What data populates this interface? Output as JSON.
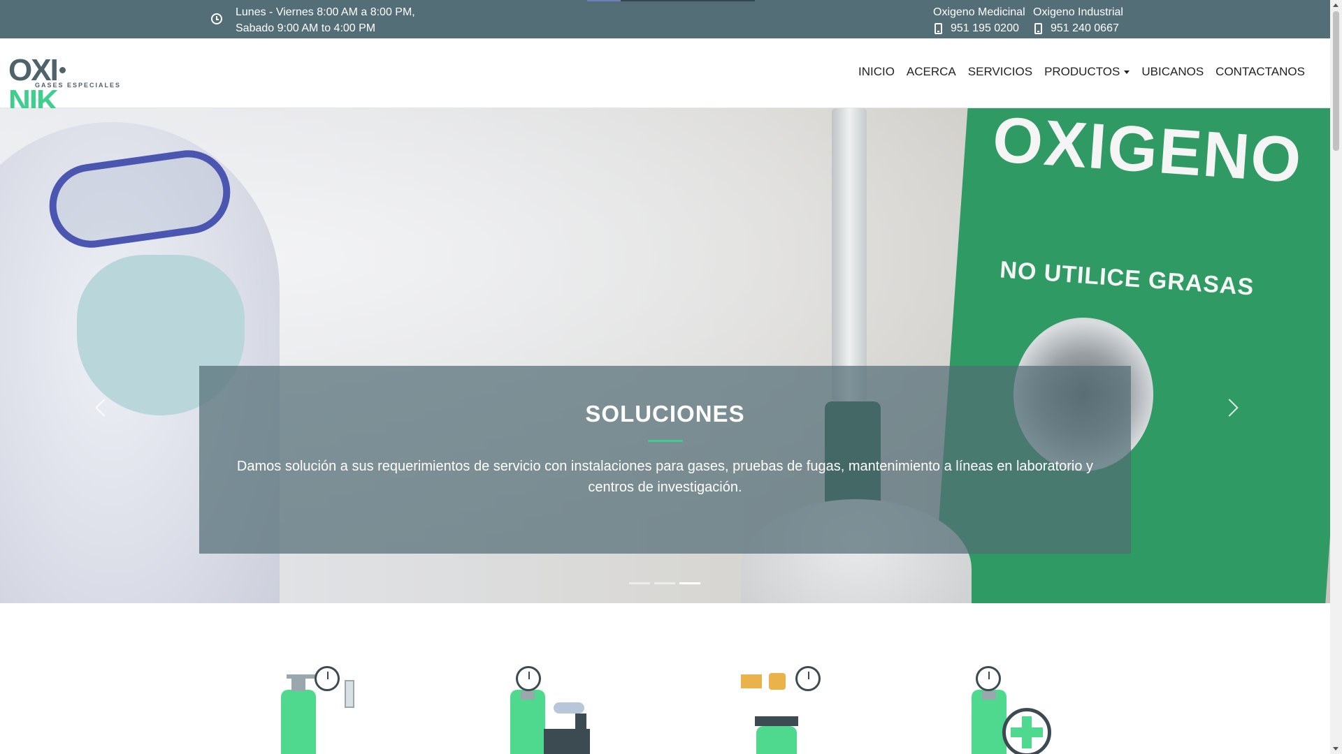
{
  "topbar": {
    "hours_line1": "Lunes - Viernes 8:00 AM a 8:00 PM,",
    "hours_line2": "Sabado 9:00 AM to 4:00 PM",
    "contacts": [
      {
        "label": "Oxigeno Medicinal",
        "phone": "951 195 0200"
      },
      {
        "label": "Oxigeno Industrial",
        "phone": "951 240 0667"
      }
    ],
    "loading_progress": 0.2
  },
  "logo": {
    "part1": "OXI",
    "part2": "NIK",
    "tagline": "GASES ESPECIALES",
    "colors": {
      "gray": "#4f6269",
      "green": "#3ecf8e"
    }
  },
  "nav": {
    "items": [
      "INICIO",
      "ACERCA",
      "SERVICIOS",
      "PRODUCTOS",
      "UBICANOS",
      "CONTACTANOS"
    ]
  },
  "hero": {
    "sign_title": "OXIGENO",
    "sign_subtitle": "NO UTILICE GRASAS",
    "caption_title": "SOLUCIONES",
    "caption_text": "Damos solución a sus requerimientos de servicio con instalaciones para gases, pruebas de fugas, mantenimiento a líneas en laboratorio y centros de investigación.",
    "slides_total": 3,
    "active_slide": 3
  },
  "services": {
    "icons": [
      "laboratory-gas-icon",
      "industrial-gas-icon",
      "regulator-gas-icon",
      "medical-gas-icon"
    ]
  },
  "colors": {
    "topbar": "#536e76",
    "accent": "#3ecf8e",
    "cylinder": "#4fd98f",
    "dark": "#3c4a52"
  }
}
